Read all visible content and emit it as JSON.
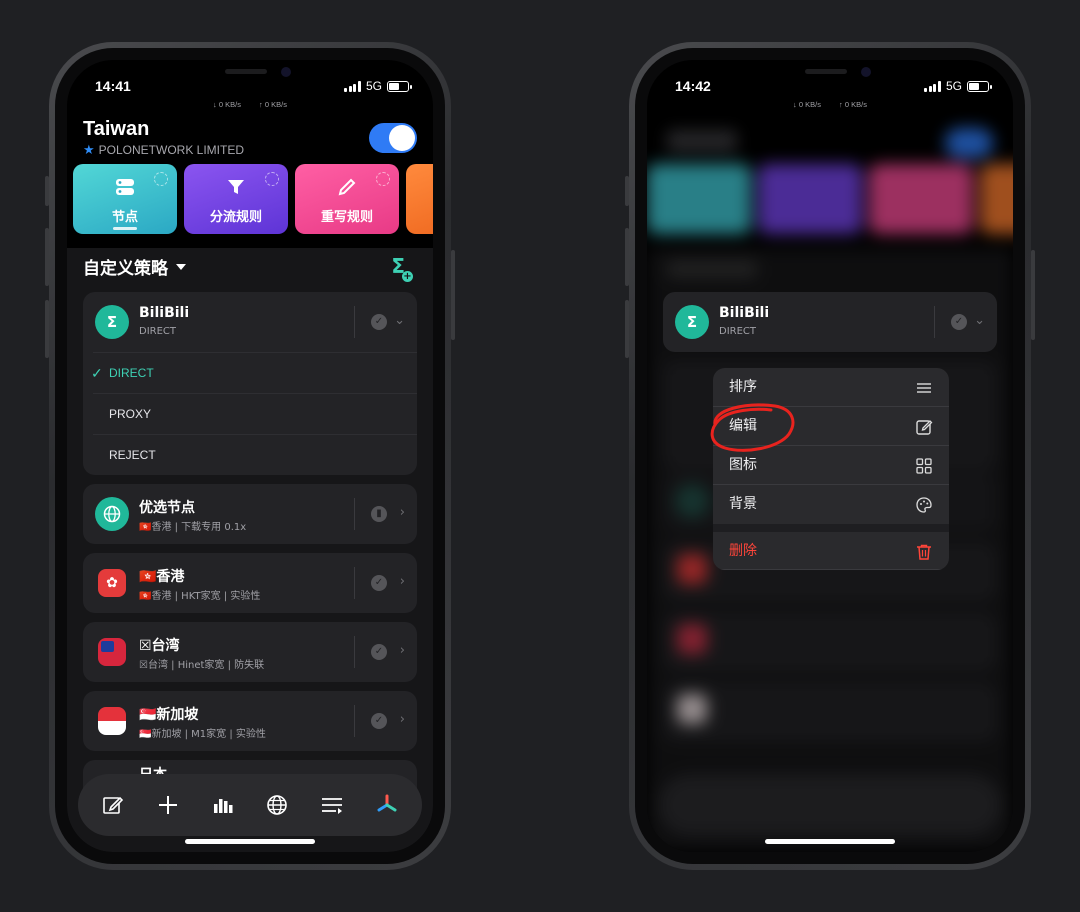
{
  "left": {
    "status": {
      "time": "14:41",
      "network": "5G",
      "down": "↓ 0 KB/s",
      "up": "↑ 0 KB/s"
    },
    "header": {
      "title": "Taiwan",
      "subtitle": "POLONETWORK LIMITED"
    },
    "tiles": [
      {
        "label": "节点",
        "icon": "server-icon"
      },
      {
        "label": "分流规则",
        "icon": "filter-icon"
      },
      {
        "label": "重写规则",
        "icon": "pencil-icon"
      },
      {
        "label": "",
        "icon": ""
      }
    ],
    "section_title": "自定义策略",
    "bilibili": {
      "name": "BiliBili",
      "sub": "DIRECT",
      "avatar": "Σ"
    },
    "options": [
      "DIRECT",
      "PROXY",
      "REJECT"
    ],
    "groups": [
      {
        "name": "优选节点",
        "sub": "🇭🇰香港 | 下载专用 0.1x"
      },
      {
        "name": "🇭🇰香港",
        "sub": "🇭🇰香港 | HKT家宽 | 实验性"
      },
      {
        "name": "☒台湾",
        "sub": "☒台湾 | Hinet家宽 | 防失联"
      },
      {
        "name": "🇸🇬新加坡",
        "sub": "🇸🇬新加坡 | M1家宽 | 实验性"
      },
      {
        "name": "日本",
        "sub": ""
      }
    ]
  },
  "right": {
    "status": {
      "time": "14:42",
      "network": "5G",
      "down": "↓ 0 KB/s",
      "up": "↑ 0 KB/s"
    },
    "bilibili": {
      "name": "BiliBili",
      "sub": "DIRECT",
      "avatar": "Σ"
    },
    "menu": [
      {
        "label": "排序",
        "icon": "lines-icon"
      },
      {
        "label": "编辑",
        "icon": "edit-icon"
      },
      {
        "label": "图标",
        "icon": "grid-icon"
      },
      {
        "label": "背景",
        "icon": "palette-icon"
      }
    ],
    "delete_label": "删除"
  },
  "colors": {
    "accent": "#3ed1b4",
    "danger": "#ff453a",
    "toggle": "#2f7bf5"
  }
}
